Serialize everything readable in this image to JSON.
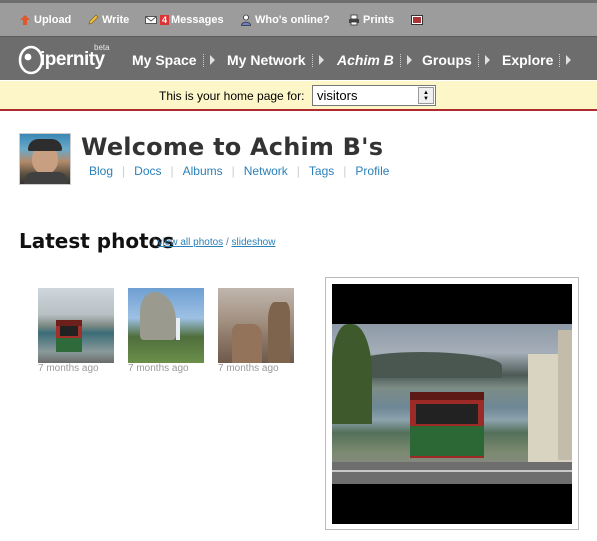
{
  "topbar": {
    "upload": "Upload",
    "write": "Write",
    "messages": "Messages",
    "messages_count": "4",
    "whos_online": "Who's online?",
    "prints": "Prints"
  },
  "nav": {
    "logo": "ipernity",
    "beta": "beta",
    "my_space": "My Space",
    "my_network": "My Network",
    "achim": "Achim B",
    "groups": "Groups",
    "explore": "Explore"
  },
  "homebar": {
    "label": "This is your home page for:",
    "selected": "visitors"
  },
  "profile": {
    "welcome": "Welcome to Achim B's",
    "links": [
      "Blog",
      "Docs",
      "Albums",
      "Network",
      "Tags",
      "Profile"
    ]
  },
  "photos": {
    "title": "Latest photos",
    "sep1": "/",
    "view_all": "view all photos",
    "sep2": "/",
    "slideshow": "slideshow",
    "items": [
      {
        "date": "7 months ago"
      },
      {
        "date": "7 months ago"
      },
      {
        "date": "7 months ago"
      }
    ]
  },
  "colors": {
    "topbar": "#9c9c9c",
    "navbar": "#6d6d6d",
    "homebar": "#fcf6c9",
    "accent_line": "#b02b2b",
    "link": "#2a80b9"
  }
}
